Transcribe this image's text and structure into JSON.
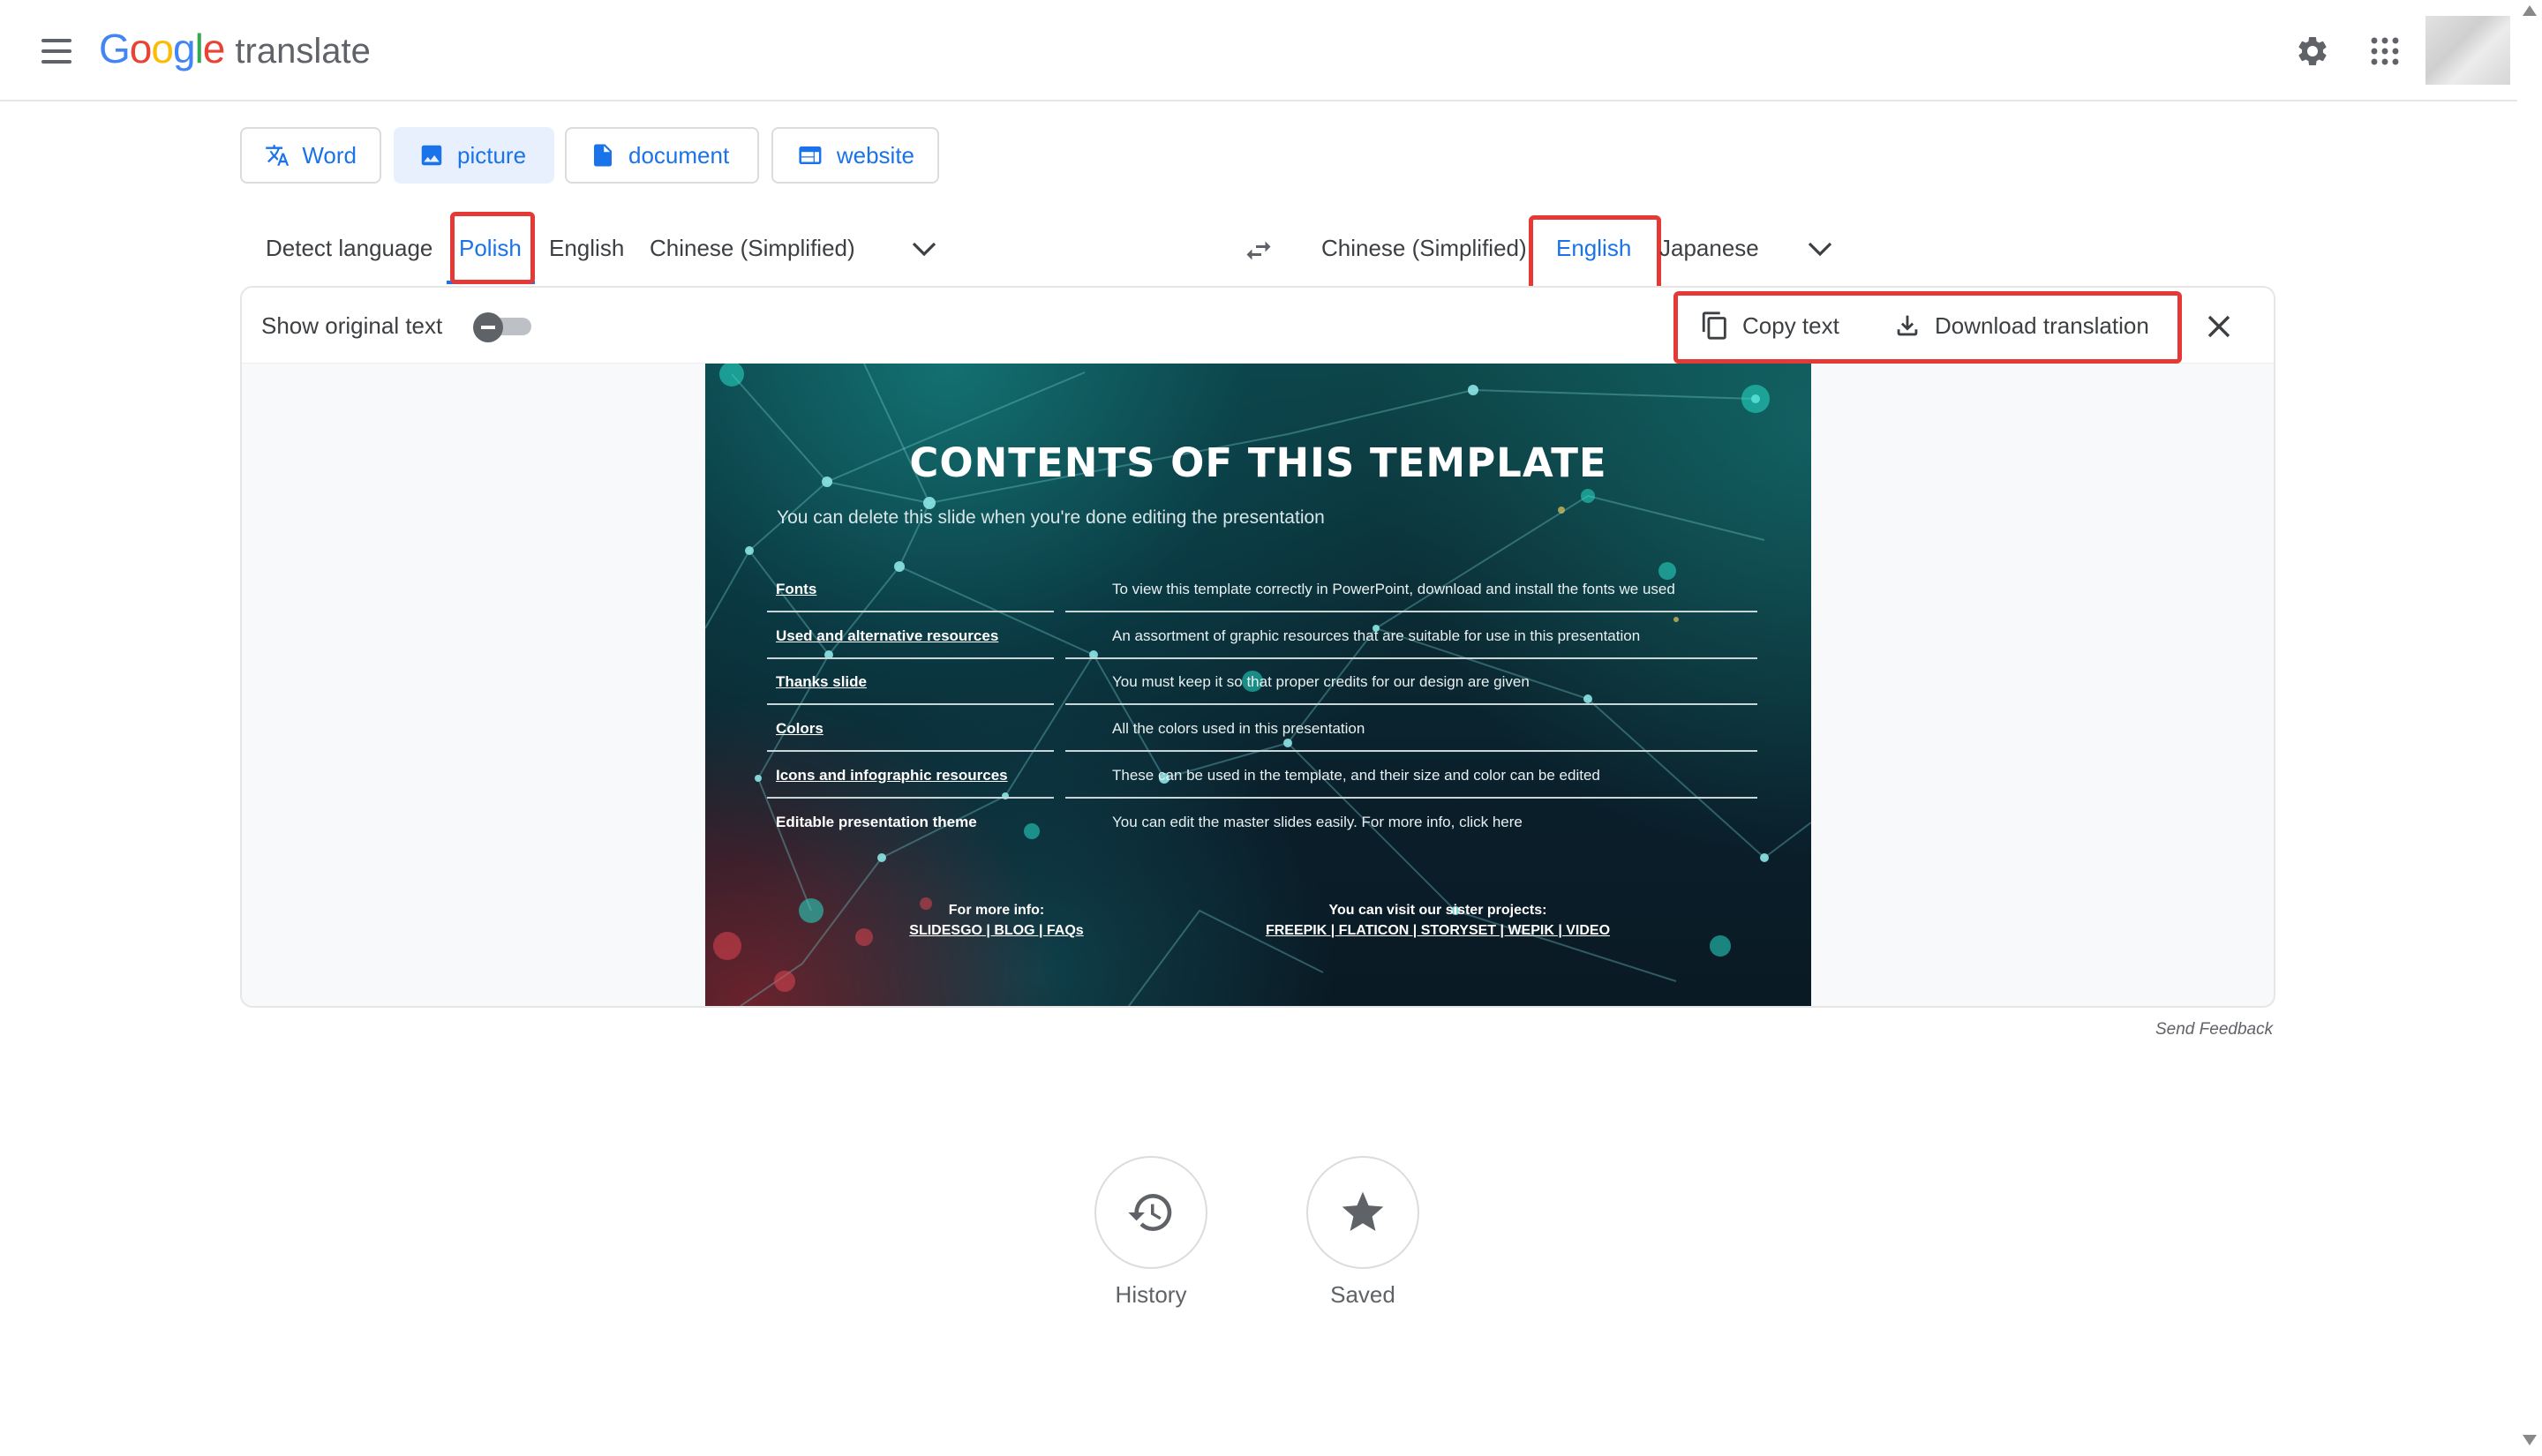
{
  "header": {
    "logo_google": [
      "G",
      "o",
      "o",
      "g",
      "l",
      "e"
    ],
    "logo_colors": [
      "#4285F4",
      "#EA4335",
      "#FBBC05",
      "#4285F4",
      "#34A853",
      "#EA4335"
    ],
    "logo_translate": "translate"
  },
  "mode_tabs": {
    "word": "Word",
    "picture": "picture",
    "document": "document",
    "website": "website"
  },
  "source_langs": {
    "detect": "Detect language",
    "polish": "Polish",
    "english": "English",
    "chinese": "Chinese (Simplified)"
  },
  "target_langs": {
    "chinese": "Chinese (Simplified)",
    "english": "English",
    "japanese": "Japanese"
  },
  "panel": {
    "show_original": "Show original text",
    "show_original_on": false,
    "copy_text": "Copy text",
    "download_translation": "Download translation"
  },
  "slide": {
    "title": "CONTENTS OF THIS TEMPLATE",
    "subtitle": "You can delete this slide when you're done editing the presentation",
    "rows": [
      {
        "key": "Fonts",
        "value": "To view this template correctly in PowerPoint, download and install the fonts we used"
      },
      {
        "key": "Used and alternative resources",
        "value": "An assortment of graphic resources that are suitable for use in this presentation"
      },
      {
        "key": "Thanks slide",
        "value": "You must keep it so that proper credits for our design are given"
      },
      {
        "key": "Colors",
        "value": "All the colors used in this presentation"
      },
      {
        "key": "Icons and infographic resources",
        "value": "These can be used in the template, and their size and color can be edited"
      },
      {
        "key": "Editable presentation theme",
        "value": "You can edit the master slides easily. For more info, click here"
      }
    ],
    "footer_left_title": "For more info:",
    "footer_left_links": "SLIDESGO | BLOG | FAQs",
    "footer_right_title": "You can visit our sister projects:",
    "footer_right_links": "FREEPIK | FLATICON | STORYSET | WEPIK | VIDEO"
  },
  "send_feedback": "Send Feedback",
  "bottom": {
    "history": "History",
    "saved": "Saved"
  },
  "colors": {
    "accent": "#1a73e8",
    "highlight": "#e53935"
  }
}
